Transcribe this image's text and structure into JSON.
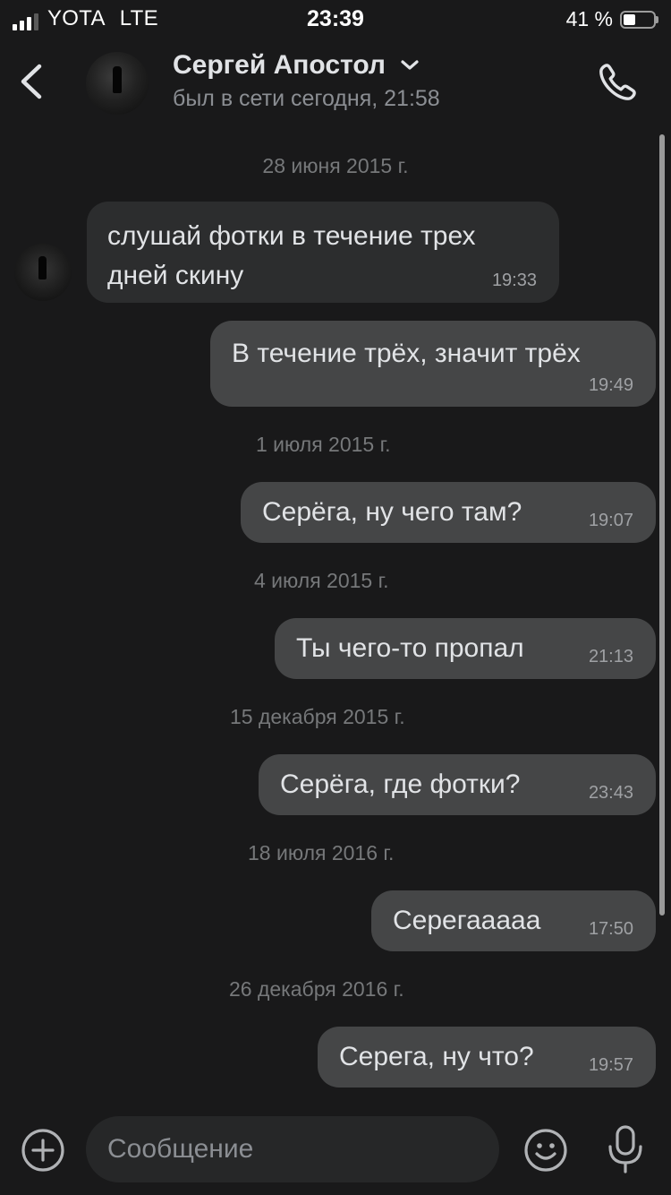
{
  "status_bar": {
    "carrier": "YOTA",
    "network": "LTE",
    "time": "23:39",
    "battery_percent": "41 %",
    "battery_level": 0.41,
    "signal_bars": 3
  },
  "header": {
    "name": "Сергей Апостол",
    "status": "был в сети сегодня, 21:58"
  },
  "messages": [
    {
      "date": "28 июня 2015 г."
    },
    {
      "direction": "in",
      "text": "слушай фотки в течение трех\nдней скину",
      "time": "19:33"
    },
    {
      "direction": "out",
      "text": "В течение трёх, значит трёх",
      "time": "19:49"
    },
    {
      "date": "1 июля 2015 г."
    },
    {
      "direction": "out",
      "text": "Серёга, ну чего там?",
      "time": "19:07"
    },
    {
      "date": "4 июля 2015 г."
    },
    {
      "direction": "out",
      "text": "Ты чего-то пропал",
      "time": "21:13"
    },
    {
      "date": "15 декабря 2015 г."
    },
    {
      "direction": "out",
      "text": "Серёга, где фотки?",
      "time": "23:43"
    },
    {
      "date": "18 июля 2016 г."
    },
    {
      "direction": "out",
      "text": "Серегааааа",
      "time": "17:50"
    },
    {
      "date": "26 декабря 2016 г."
    },
    {
      "direction": "out",
      "text": "Серега, ну что?",
      "time": "19:57"
    }
  ],
  "composer": {
    "placeholder": "Сообщение"
  },
  "colors": {
    "background": "#19191a",
    "incoming_bubble": "#2c2d2e",
    "outgoing_bubble": "#454647",
    "text": "#e1e3e6",
    "secondary_text": "#8b8e93"
  },
  "icons": {
    "back": "chevron-left-icon",
    "name_dropdown": "chevron-down-icon",
    "call": "phone-icon",
    "attach": "plus-circle-icon",
    "emoji": "smiley-icon",
    "mic": "microphone-icon"
  }
}
